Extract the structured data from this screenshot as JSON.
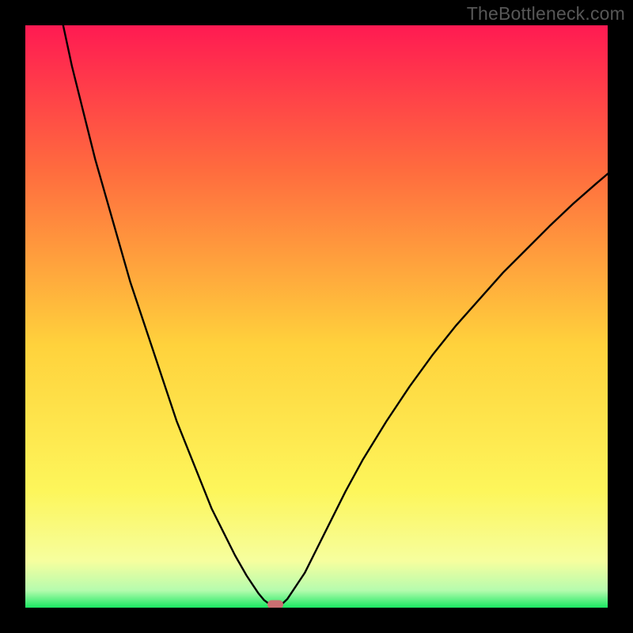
{
  "watermark": "TheBottleneck.com",
  "chart_data": {
    "type": "line",
    "title": "",
    "xlabel": "",
    "ylabel": "",
    "xlim": [
      0,
      100
    ],
    "ylim": [
      0,
      100
    ],
    "gradient_stops": [
      {
        "offset": 0,
        "color": "#ff1a52"
      },
      {
        "offset": 25,
        "color": "#ff6c3e"
      },
      {
        "offset": 55,
        "color": "#ffd23c"
      },
      {
        "offset": 80,
        "color": "#fdf65b"
      },
      {
        "offset": 92,
        "color": "#f6fe9e"
      },
      {
        "offset": 97,
        "color": "#b6fcae"
      },
      {
        "offset": 100,
        "color": "#1ae862"
      }
    ],
    "series": [
      {
        "name": "curve-left",
        "x": [
          6.5,
          8,
          10,
          12,
          14,
          16,
          18,
          20,
          22,
          24,
          26,
          28,
          30,
          32,
          34,
          36,
          38,
          39,
          40,
          41,
          42
        ],
        "y": [
          100,
          93,
          85,
          77,
          70,
          63,
          56,
          50,
          44,
          38,
          32,
          27,
          22,
          17,
          13,
          9,
          5.5,
          4,
          2.5,
          1.3,
          0.55
        ]
      },
      {
        "name": "curve-right",
        "x": [
          44,
          45,
          46,
          48,
          50,
          52,
          55,
          58,
          62,
          66,
          70,
          74,
          78,
          82,
          86,
          90,
          94,
          98,
          100
        ],
        "y": [
          0.55,
          1.5,
          3,
          6,
          10,
          14,
          20,
          25.5,
          32,
          38,
          43.5,
          48.5,
          53,
          57.5,
          61.5,
          65.5,
          69.3,
          72.8,
          74.5
        ]
      }
    ],
    "marker": {
      "x": 43,
      "y": 0.5
    }
  }
}
